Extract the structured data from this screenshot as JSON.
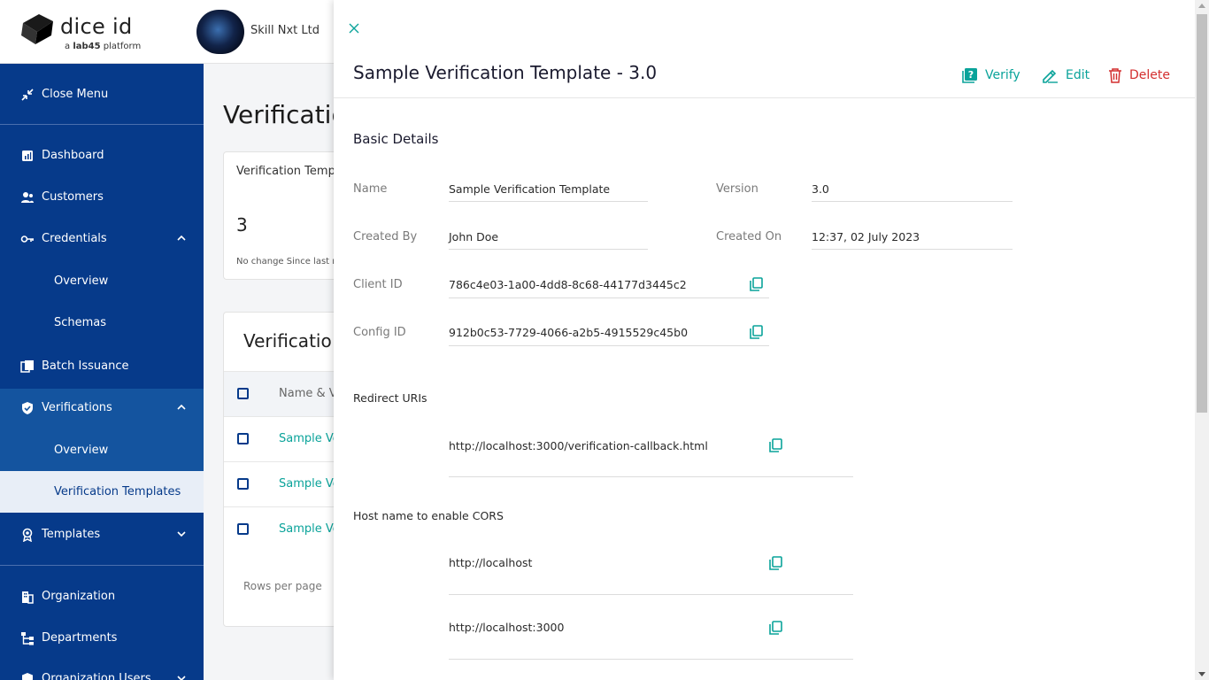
{
  "brand": {
    "name": "dice id",
    "tagline_prefix": "a ",
    "tagline_bold": "lab45",
    "tagline_suffix": " platform"
  },
  "organization": {
    "name": "Skill Nxt Ltd"
  },
  "sidebar": {
    "close_menu": "Close Menu",
    "dashboard": "Dashboard",
    "customers": "Customers",
    "credentials": "Credentials",
    "credentials_overview": "Overview",
    "credentials_schemas": "Schemas",
    "batch_issuance": "Batch Issuance",
    "verifications": "Verifications",
    "verifications_overview": "Overview",
    "verification_templates": "Verification Templates",
    "templates": "Templates",
    "organization": "Organization",
    "departments": "Departments",
    "organization_users": "Organization Users"
  },
  "background": {
    "page_title": "Verificatio",
    "card_title": "Verification Temp",
    "card_count": "3",
    "card_footer": "No change Since last mo",
    "table_title": "Verificatio",
    "table_header": "Name & V",
    "rows": [
      "Sample Ve",
      "Sample Ve",
      "Sample Ve"
    ],
    "rows_per_page": "Rows per page"
  },
  "drawer": {
    "title": "Sample Verification Template - 3.0",
    "actions": {
      "verify": "Verify",
      "edit": "Edit",
      "delete": "Delete"
    },
    "section_title": "Basic Details",
    "fields": {
      "name_label": "Name",
      "name_value": "Sample Verification Template",
      "version_label": "Version",
      "version_value": "3.0",
      "created_by_label": "Created By",
      "created_by_value": "John Doe",
      "created_on_label": "Created On",
      "created_on_value": "12:37, 02 July 2023",
      "client_id_label": "Client ID",
      "client_id_value": "786c4e03-1a00-4dd8-8c68-44177d3445c2",
      "config_id_label": "Config ID",
      "config_id_value": "912b0c53-7729-4066-a2b5-4915529c45b0"
    },
    "redirect_uris_label": "Redirect URIs",
    "redirect_uris": [
      "http://localhost:3000/verification-callback.html"
    ],
    "cors_label": "Host name to enable CORS",
    "cors_hosts": [
      "http://localhost",
      "http://localhost:3000"
    ]
  },
  "colors": {
    "sidebar": "#063a8a",
    "accent": "#0aa39a",
    "danger": "#d32f2f"
  }
}
